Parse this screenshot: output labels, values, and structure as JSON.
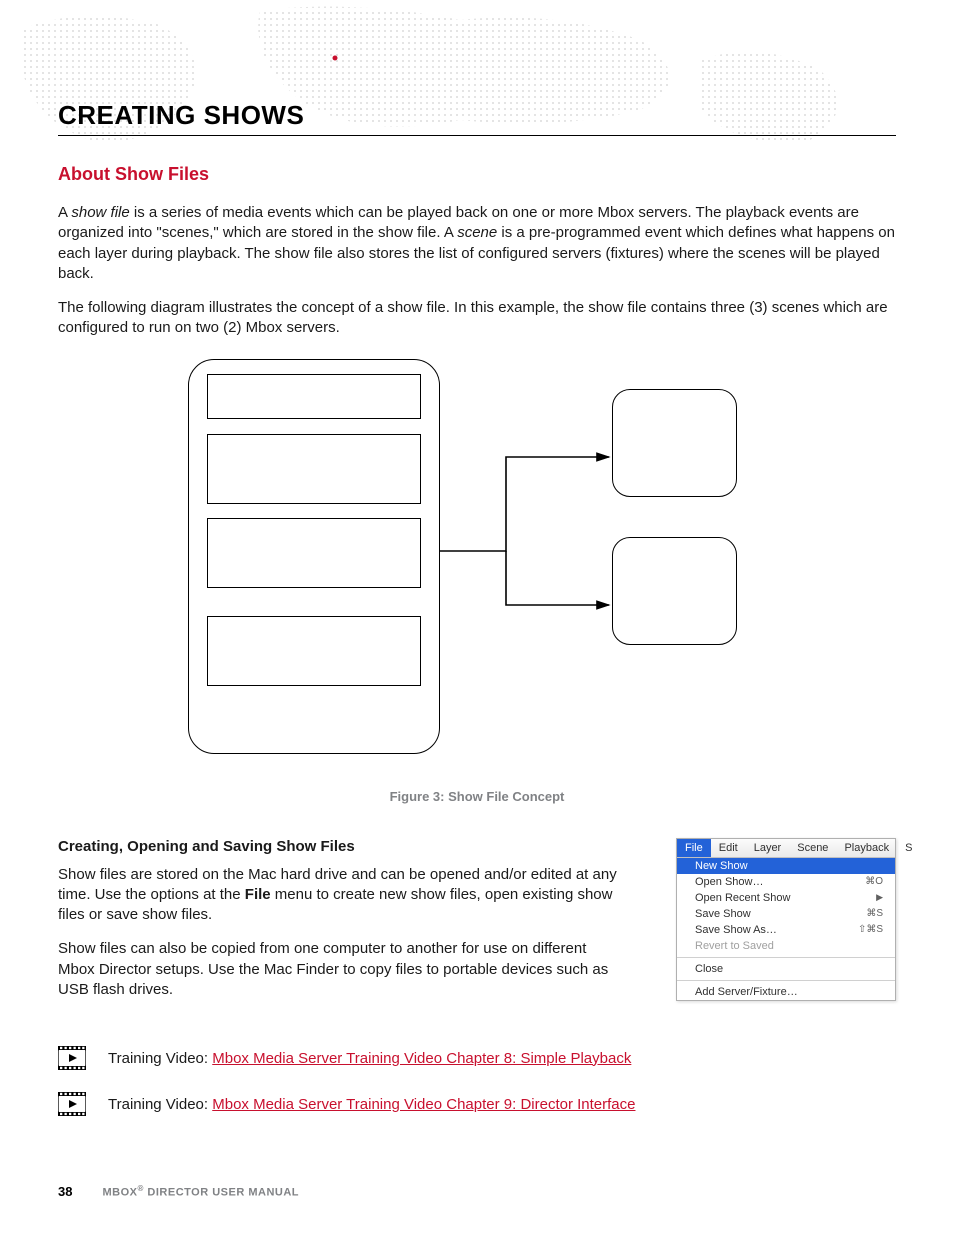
{
  "heading": "CREATING SHOWS",
  "section": "About Show Files",
  "para1_a": "A ",
  "para1_em1": "show file",
  "para1_b": " is a series of media events which can be played back on one or more Mbox servers. The playback events are organized into \"scenes,\" which are stored in the show file. A ",
  "para1_em2": "scene",
  "para1_c": " is a pre-programmed event which defines what happens on each layer during playback. The show file also stores the list of configured servers (fixtures) where the scenes will be played back.",
  "para2": "The following diagram illustrates the concept of a show file. In this example, the show file contains three (3) scenes which are configured to run on two (2) Mbox servers.",
  "figure_caption": "Figure 3:  Show File Concept",
  "h3": "Creating, Opening and Saving Show Files",
  "para3_a": "Show files are stored on the Mac hard drive and can be opened and/or edited at any time. Use the options at the ",
  "para3_bold": "File",
  "para3_b": " menu to create new show files, open existing show files or save show files.",
  "para4": "Show files can also be copied from one computer to another for use on different Mbox Director setups. Use the Mac Finder to copy files to portable devices such as USB flash drives.",
  "menubar": {
    "items": [
      "File",
      "Edit",
      "Layer",
      "Scene",
      "Playback",
      "S"
    ],
    "active_index": 0
  },
  "menu_items": [
    {
      "label": "New Show",
      "selected": true
    },
    {
      "label": "Open Show…",
      "shortcut": "⌘O"
    },
    {
      "label": "Open Recent Show",
      "submenu": true
    },
    {
      "label": "Save Show",
      "shortcut": "⌘S"
    },
    {
      "label": "Save Show As…",
      "shortcut": "⇧⌘S"
    },
    {
      "label": "Revert to Saved",
      "disabled": true
    },
    {
      "divider": true
    },
    {
      "label": "Close"
    },
    {
      "divider": true
    },
    {
      "label": "Add Server/Fixture…"
    }
  ],
  "training": [
    {
      "prefix": "Training Video: ",
      "link": "Mbox Media Server Training Video Chapter 8: Simple Playback"
    },
    {
      "prefix": "Training Video: ",
      "link": "Mbox Media Server Training Video Chapter 9: Director Interface"
    }
  ],
  "footer": {
    "page": "38",
    "manual_a": "MBOX",
    "manual_b": " DIRECTOR USER MANUAL"
  }
}
